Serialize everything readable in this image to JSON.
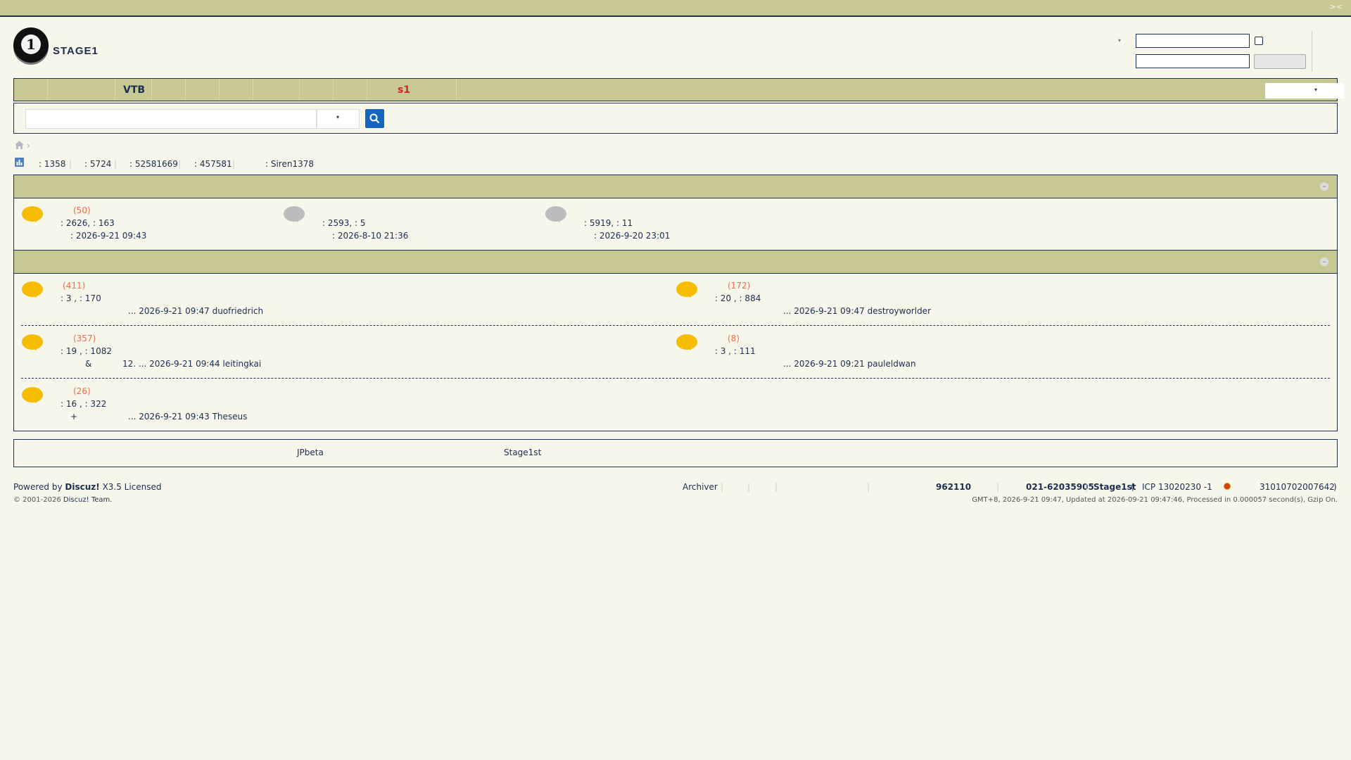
{
  "header": {
    "topbar_toggle": "><",
    "logo_text": "STAGE1",
    "logo_glyph": "1",
    "login_dropdown_caret": "▾",
    "login_username_value": "",
    "login_password_value": "",
    "login_button_label": ""
  },
  "nav": {
    "items": [
      {
        "label": ""
      },
      {
        "label": ""
      },
      {
        "label": "VTB"
      },
      {
        "label": ""
      },
      {
        "label": ""
      },
      {
        "label": ""
      },
      {
        "label": ""
      },
      {
        "label": ""
      },
      {
        "label": ""
      },
      {
        "label": "s1",
        "color": "#e02020"
      }
    ],
    "select_caret": "▾"
  },
  "search": {
    "input_value": "",
    "select_caret": "▾"
  },
  "breadcrumb": {
    "separator": "›"
  },
  "stats": {
    "items": [
      ": 1358",
      ": 5724",
      ": 52581669",
      ": 457581",
      ": Siren1378"
    ]
  },
  "section1": {
    "toggle": "–",
    "forums": [
      {
        "count": "(50)",
        "stats": ": 2626,     : 163",
        "last": ": 2026-9-21 09:43",
        "icon": "bubble-new"
      },
      {
        "count": "",
        "stats": ": 2593,     : 5",
        "last": ": 2026-8-10 21:36",
        "icon": "bubble-old"
      },
      {
        "count": "",
        "stats": ": 5919,     : 11",
        "last": ": 2026-9-20 23:01",
        "icon": "bubble-old"
      }
    ]
  },
  "section2": {
    "toggle": "–",
    "forums": [
      {
        "count": "(411)",
        "stats": ": 3  ,     : 170",
        "last": "... 2026-9-21 09:47 duofriedrich",
        "prefix": ""
      },
      {
        "count": "(172)",
        "stats": ": 20  ,     : 884",
        "last": "... 2026-9-21 09:47 destroyworlder",
        "prefix": ""
      },
      {
        "count": "(357)",
        "stats": ": 19  ,     : 1082",
        "last": "12. ... 2026-9-21 09:44 leitingkai",
        "prefix": "&"
      },
      {
        "count": "(8)",
        "stats": ": 3  ,     : 111",
        "last": "... 2026-9-21 09:21 pauleldwan",
        "prefix": ""
      },
      {
        "count": "(26)",
        "stats": ": 16  ,     : 322",
        "last": "... 2026-9-21 09:43 Theseus",
        "prefix": "+"
      }
    ]
  },
  "friend_links": [
    "JPbeta",
    "Stage1st"
  ],
  "footer": {
    "powered_by": "Powered by",
    "brand": "Discuz!",
    "version": "X3.5 Licensed",
    "copyright": "© 2001-2026",
    "team": "Discuz! Team.",
    "archiver": "Archiver",
    "phone_short": "962110",
    "phone": "021-62035905",
    "site": "Stage1st",
    "icp_open": "(",
    "icp": "ICP  13020230  -1",
    "police_no": "31010702007642",
    "icp_close": ")",
    "timing": "GMT+8, 2026-9-21 09:47, Updated at 2026-09-21 09:47:46, Processed in 0.000057 second(s), Gzip On."
  }
}
